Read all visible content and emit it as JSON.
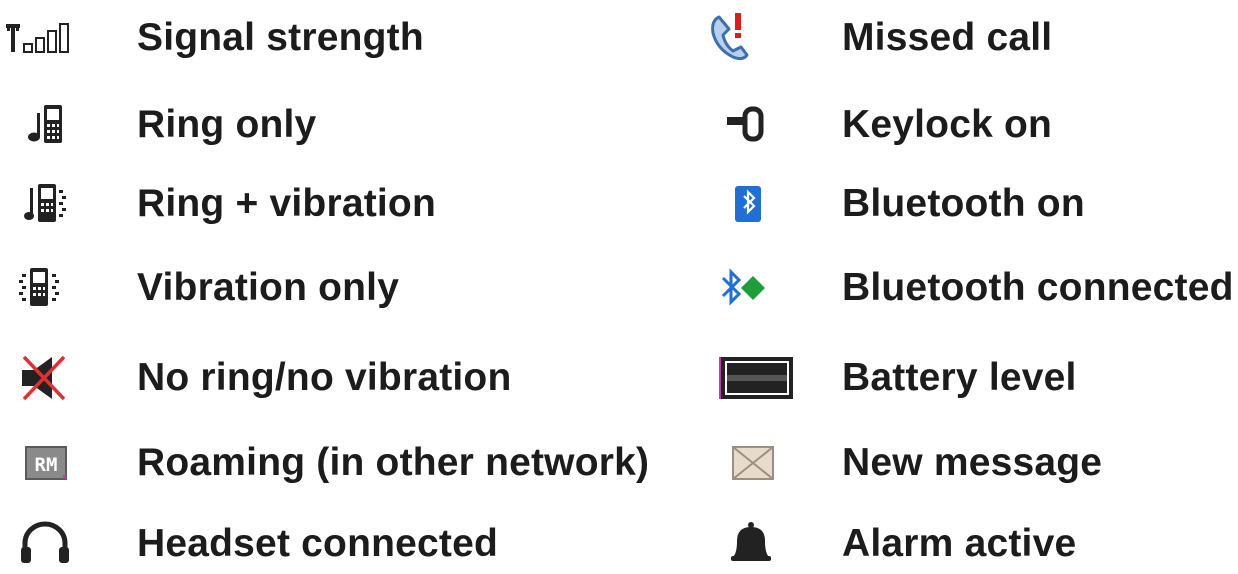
{
  "left_column": [
    {
      "icon": "signal-strength-icon",
      "label": "Signal strength"
    },
    {
      "icon": "ring-only-icon",
      "label": "Ring only"
    },
    {
      "icon": "ring-vibration-icon",
      "label": "Ring + vibration"
    },
    {
      "icon": "vibration-only-icon",
      "label": "Vibration only"
    },
    {
      "icon": "silent-icon",
      "label": "No ring/no vibration"
    },
    {
      "icon": "roaming-icon",
      "label": "Roaming (in other network)"
    },
    {
      "icon": "headset-icon",
      "label": "Headset connected"
    }
  ],
  "right_column": [
    {
      "icon": "missed-call-icon",
      "label": "Missed call"
    },
    {
      "icon": "keylock-icon",
      "label": "Keylock on"
    },
    {
      "icon": "bluetooth-on-icon",
      "label": "Bluetooth on"
    },
    {
      "icon": "bluetooth-connected-icon",
      "label": "Bluetooth connected"
    },
    {
      "icon": "battery-level-icon",
      "label": "Battery level"
    },
    {
      "icon": "new-message-icon",
      "label": "New message"
    },
    {
      "icon": "alarm-icon",
      "label": "Alarm active"
    }
  ],
  "roaming_badge_text": "RM",
  "colors": {
    "text": "#1c1c1c",
    "icon_dark": "#222222",
    "bluetooth_blue": "#1f6fd6",
    "bluetooth_green": "#1e9e3a",
    "missed_call_red": "#e01a1a",
    "missed_call_blue": "#3b6fb0",
    "silent_cross_red": "#e03030",
    "message_tan": "#e7dccb"
  }
}
